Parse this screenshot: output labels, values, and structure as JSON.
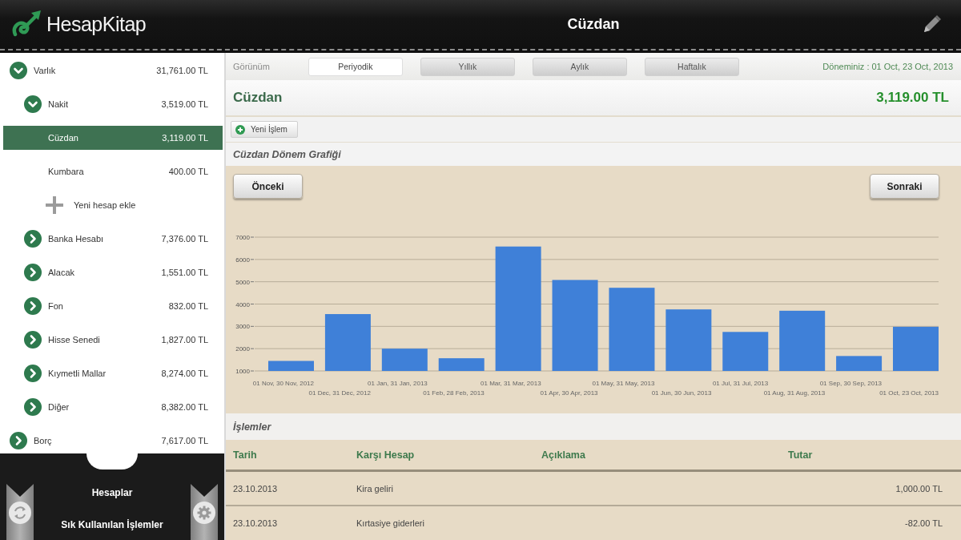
{
  "header": {
    "app_name": "HesapKitap",
    "title": "Cüzdan"
  },
  "sidebar": {
    "tree": [
      {
        "kind": "group",
        "label": "Varlık",
        "amount": "31,761.00 TL",
        "expanded": true,
        "selected": false,
        "children": [
          {
            "kind": "group",
            "label": "Nakit",
            "amount": "3,519.00 TL",
            "expanded": true,
            "selected": false,
            "children": [
              {
                "kind": "account",
                "label": "Cüzdan",
                "amount": "3,119.00 TL",
                "selected": true
              },
              {
                "kind": "account",
                "label": "Kumbara",
                "amount": "400.00 TL",
                "selected": false
              },
              {
                "kind": "add",
                "label": "Yeni hesap ekle"
              }
            ]
          },
          {
            "kind": "group",
            "label": "Banka Hesabı",
            "amount": "7,376.00 TL",
            "expanded": false,
            "selected": false
          },
          {
            "kind": "group",
            "label": "Alacak",
            "amount": "1,551.00 TL",
            "expanded": false,
            "selected": false
          },
          {
            "kind": "group",
            "label": "Fon",
            "amount": "832.00 TL",
            "expanded": false,
            "selected": false
          },
          {
            "kind": "group",
            "label": "Hisse Senedi",
            "amount": "1,827.00 TL",
            "expanded": false,
            "selected": false
          },
          {
            "kind": "group",
            "label": "Kıymetli Mallar",
            "amount": "8,274.00 TL",
            "expanded": false,
            "selected": false
          },
          {
            "kind": "group",
            "label": "Diğer",
            "amount": "8,382.00 TL",
            "expanded": false,
            "selected": false
          }
        ]
      },
      {
        "kind": "group",
        "label": "Borç",
        "amount": "7,617.00 TL",
        "expanded": false,
        "selected": false
      }
    ],
    "bottom_links": [
      "Hesaplar",
      "Sık Kullanılan İşlemler"
    ]
  },
  "view_bar": {
    "label": "Görünüm",
    "tabs": [
      {
        "label": "Periyodik",
        "selected": true
      },
      {
        "label": "Yıllık",
        "selected": false
      },
      {
        "label": "Aylık",
        "selected": false
      },
      {
        "label": "Haftalık",
        "selected": false
      }
    ],
    "period": "Döneminiz : 01 Oct, 23 Oct, 2013"
  },
  "account_header": {
    "name": "Cüzdan",
    "balance": "3,119.00 TL"
  },
  "toolbar": {
    "new_button": "Yeni İşlem"
  },
  "chart_section": {
    "title": "Cüzdan Dönem Grafiği",
    "prev_button": "Önceki",
    "next_button": "Sonraki",
    "chart_data": {
      "type": "bar",
      "categories": [
        "01 Nov, 30 Nov, 2012",
        "01 Dec, 31 Dec, 2012",
        "01 Jan, 31 Jan, 2013",
        "01 Feb, 28 Feb, 2013",
        "01 Mar, 31 Mar, 2013",
        "01 Apr, 30 Apr, 2013",
        "01 May, 31 May, 2013",
        "01 Jun, 30 Jun, 2013",
        "01 Jul, 31 Jul, 2013",
        "01 Aug, 31 Aug, 2013",
        "01 Sep, 30 Sep, 2013",
        "01 Oct, 23 Oct, 2013"
      ],
      "series": [
        {
          "color": "#3f80d8",
          "values": [
            1450,
            3550,
            2000,
            1570,
            6580,
            5080,
            4730,
            3760,
            2750,
            3700,
            1670,
            2980
          ]
        }
      ],
      "ylim": [
        1000,
        7000
      ],
      "yticks": [
        1000,
        2000,
        3000,
        4000,
        5000,
        6000,
        7000
      ],
      "grid": true
    }
  },
  "transactions": {
    "title": "İşlemler",
    "columns": [
      "Tarih",
      "Karşı Hesap",
      "Açıklama",
      "Tutar"
    ],
    "rows": [
      {
        "date": "23.10.2013",
        "counter_account": "Kira geliri",
        "amount": "1,000.00 TL"
      },
      {
        "date": "23.10.2013",
        "counter_account": "Kırtasiye giderleri",
        "amount": "-82.00 TL"
      }
    ]
  }
}
